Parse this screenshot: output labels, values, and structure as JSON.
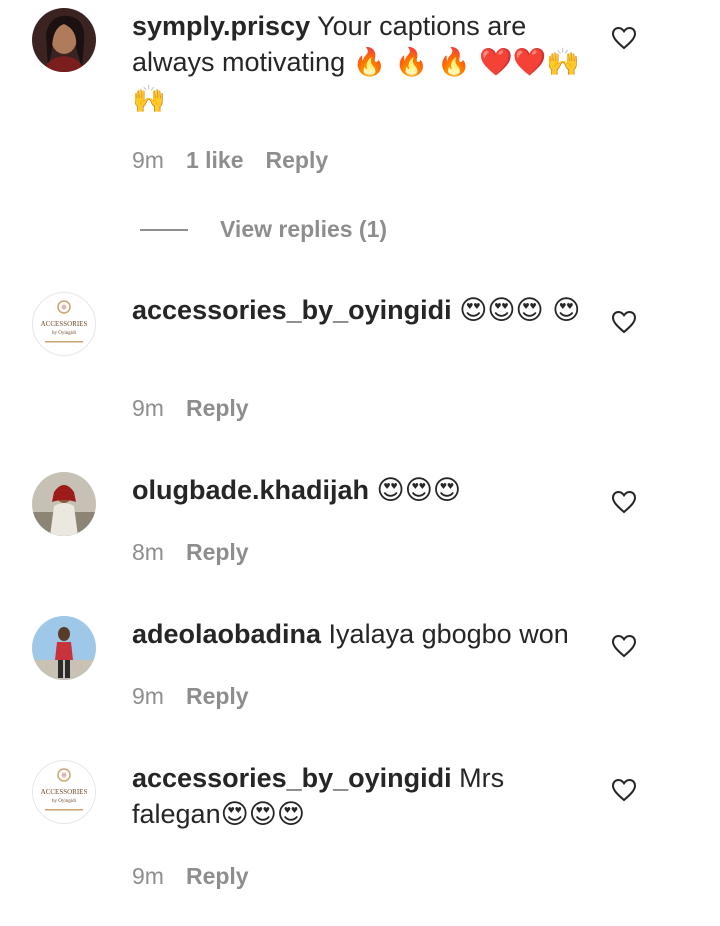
{
  "comments": [
    {
      "username": "symply.priscy",
      "text": " Your captions are always motivating ",
      "emojis": "🔥 🔥 🔥 ❤️❤️🙌 🙌",
      "time": "9m",
      "likes": "1 like",
      "reply_label": "Reply",
      "view_replies": "View replies (1)",
      "avatar_icon": "profile-photo",
      "like_icon": "heart-outline-icon"
    },
    {
      "username": "accessories_by_oyingidi",
      "text": " ",
      "emojis": "😍😍😍 😍",
      "time": "9m",
      "reply_label": "Reply",
      "avatar_logo": "ACCESSORIES",
      "avatar_logo_sub": "by Oyingidi",
      "like_icon": "heart-outline-icon"
    },
    {
      "username": "olugbade.khadijah",
      "text": " ",
      "emojis": "😍😍😍",
      "time": "8m",
      "reply_label": "Reply",
      "avatar_icon": "profile-photo",
      "like_icon": "heart-outline-icon"
    },
    {
      "username": "adeolaobadina",
      "text": " Iyalaya gbogbo won",
      "emojis": "",
      "time": "9m",
      "reply_label": "Reply",
      "avatar_icon": "profile-photo",
      "like_icon": "heart-outline-icon"
    },
    {
      "username": "accessories_by_oyingidi",
      "text": " Mrs falegan",
      "emojis": "😍😍😍",
      "time": "9m",
      "reply_label": "Reply",
      "avatar_logo": "ACCESSORIES",
      "avatar_logo_sub": "by Oyingidi",
      "like_icon": "heart-outline-icon"
    }
  ]
}
